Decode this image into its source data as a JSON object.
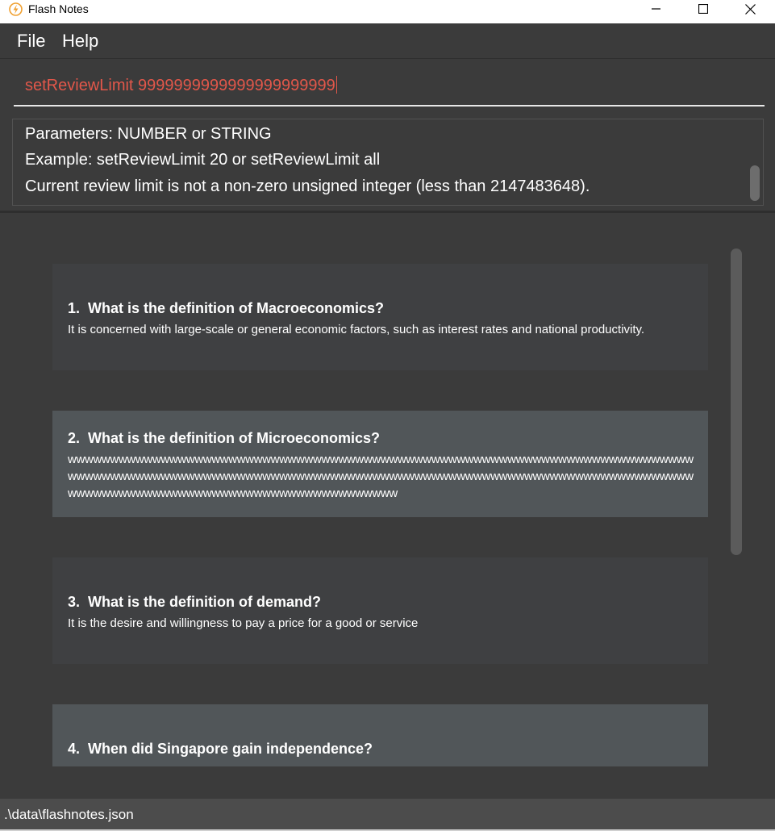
{
  "window": {
    "title": "Flash Notes",
    "icon": "flash-icon",
    "controls": [
      "minimize-icon",
      "maximize-icon",
      "close-icon"
    ]
  },
  "menu": {
    "file_label": "File",
    "help_label": "Help"
  },
  "command": {
    "value": "setReviewLimit 9999999999999999999999",
    "text_color": "#e2574a"
  },
  "result": {
    "line1": "Parameters: NUMBER or STRING",
    "line2": "Example: setReviewLimit 20 or setReviewLimit all",
    "line3": "Current review limit is not a non-zero unsigned integer (less than 2147483648)."
  },
  "cards": [
    {
      "index": "1.",
      "question": "What is the definition of Macroeconomics?",
      "answer": "It is concerned with large-scale or general economic factors, such as interest rates and national productivity."
    },
    {
      "index": "2.",
      "question": "What is the definition of Microeconomics?",
      "answer": "wwwwwwwwwwwwwwwwwwwwwwwwwwwwwwwwwwwwwwwwwwwwwwwwwwwwwwwwwwwwwwwwwwwwwwwwwwwwwwwwwwwwwwwwwwwwwwwwwwwwwwwwwwwwwwwwwwwwwwwwwwwwwwwwwwwwwwwwwwwwwwwwwwwwwwwwwwwwwwwwwwwwwwwwwwwwwwwwwwwwwwwwwww"
    },
    {
      "index": "3.",
      "question": "What is the definition of demand?",
      "answer": "It is the desire and willingness to pay a price for a good or service"
    },
    {
      "index": "4.",
      "question": "When did Singapore gain independence?",
      "answer": ""
    }
  ],
  "status": {
    "path": ".\\data\\flashnotes.json"
  },
  "colors": {
    "background": "#3b3b3b",
    "card_even": "#3f4042",
    "card_odd": "#515659",
    "status_bar": "#4c4c4c",
    "accent_icon": "#f0a030"
  }
}
